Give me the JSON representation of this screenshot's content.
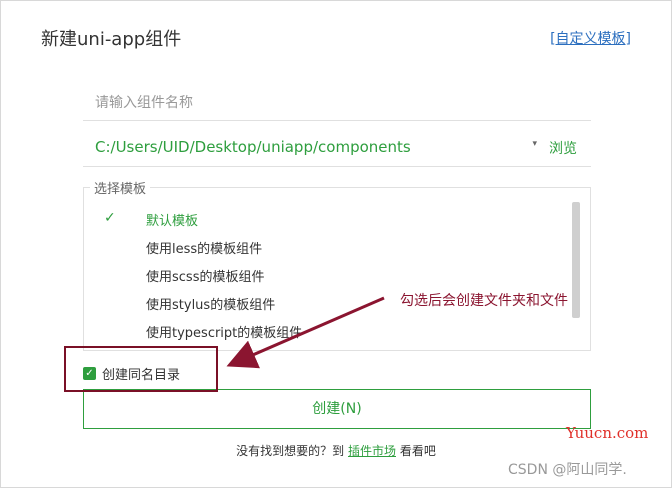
{
  "dialog": {
    "title": "新建uni-app组件",
    "custom_template_open": "[",
    "custom_template_label": "自定义模板",
    "custom_template_close": "]"
  },
  "form": {
    "name_placeholder": "请输入组件名称",
    "path_value": "C:/Users/UID/Desktop/uniapp/components",
    "path_caret": "▾",
    "browse_label": "浏览"
  },
  "templates": {
    "legend": "选择模板",
    "check_glyph": "✓",
    "items": [
      {
        "label": "默认模板",
        "selected": true
      },
      {
        "label": "使用less的模板组件",
        "selected": false
      },
      {
        "label": "使用scss的模板组件",
        "selected": false
      },
      {
        "label": "使用stylus的模板组件",
        "selected": false
      },
      {
        "label": "使用typescript的模板组件",
        "selected": false
      }
    ]
  },
  "options": {
    "same_dir_label": "创建同名目录",
    "same_dir_checked": true,
    "checkbox_glyph": "✓"
  },
  "actions": {
    "create_label": "创建(N)"
  },
  "footer": {
    "prefix": "没有找到想要的？到 ",
    "market_link": "插件市场",
    "suffix": " 看看吧"
  },
  "annotation": {
    "text": "勾选后会创建文件夹和文件"
  },
  "watermarks": {
    "yuucn": "Yuucn.com",
    "csdn": "CSDN @阿山同学."
  },
  "colors": {
    "accent": "#2e9e3e",
    "link": "#2c6fbf",
    "annotation": "#8b1530"
  }
}
